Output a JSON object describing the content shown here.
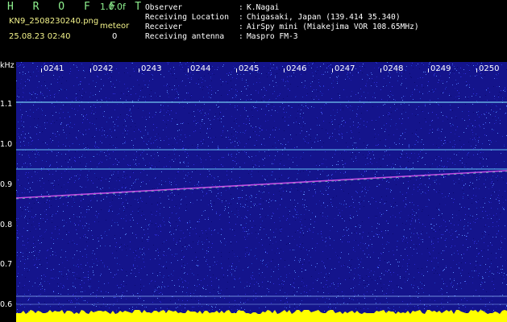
{
  "header": {
    "app_title": "H R O F F T",
    "version": "1.0.0f",
    "filename": "KN9_2508230240.png",
    "meteor_label": "meteor",
    "meteor_count": "0",
    "datetime": "25.08.23 02:40"
  },
  "info": [
    {
      "key": "Observer",
      "colon": ":",
      "value": "K.Nagai"
    },
    {
      "key": "Receiving Location",
      "colon": ":",
      "value": "Chigasaki, Japan (139.414 35.340)"
    },
    {
      "key": "Receiver",
      "colon": ":",
      "value": "AirSpy mini (Miakejima VOR 108.65MHz)"
    },
    {
      "key": "Receiving antenna",
      "colon": ":",
      "value": "Maspro FM-3"
    }
  ],
  "axis": {
    "unit": "kHz",
    "y_ticks": [
      "1.1",
      "1.0",
      "0.9",
      "0.8",
      "0.7",
      "0.6"
    ],
    "time_ticks": [
      "0241",
      "0242",
      "0243",
      "0244",
      "0245",
      "0246",
      "0247",
      "0248",
      "0249",
      "0250"
    ]
  },
  "colors": {
    "background": "#14148c",
    "carrier_line": "#7fe0ff",
    "noise_floor": "#ffff00",
    "trace": "#ff60ff"
  }
}
